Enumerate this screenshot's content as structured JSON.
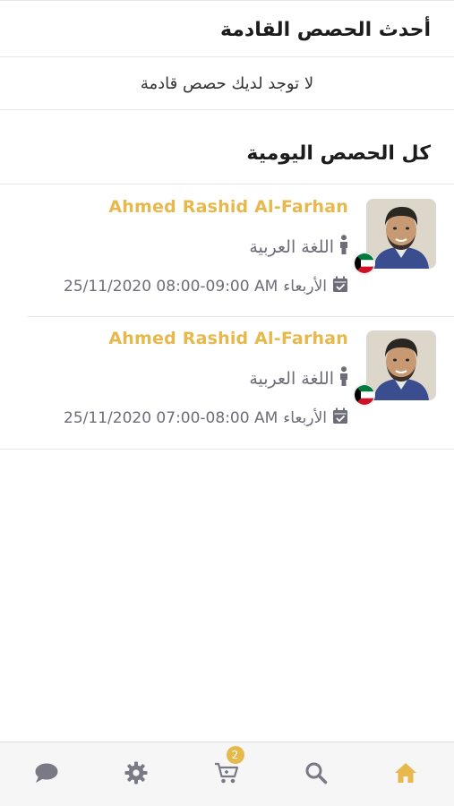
{
  "upcoming": {
    "title": "أحدث الحصص القادمة",
    "empty_message": "لا توجد لديك حصص قادمة"
  },
  "all_lessons": {
    "title": "كل الحصص اليومية",
    "items": [
      {
        "teacher": "Ahmed Rashid Al-Farhan",
        "subject": "اللغة العربية",
        "day": "الأربعاء",
        "date_time": "25/11/2020 08:00-09:00 AM"
      },
      {
        "teacher": "Ahmed Rashid Al-Farhan",
        "subject": "اللغة العربية",
        "day": "الأربعاء",
        "date_time": "25/11/2020 07:00-08:00 AM"
      }
    ]
  },
  "tabbar": {
    "cart_count": "2",
    "tabs": [
      "chat-icon",
      "settings-icon",
      "cart-icon",
      "search-icon",
      "home-icon"
    ],
    "active_color": "#e7b94c",
    "inactive_color": "#7a7a86"
  },
  "colors": {
    "accent": "#e7b94c",
    "secondary_text": "#6d6d78"
  }
}
